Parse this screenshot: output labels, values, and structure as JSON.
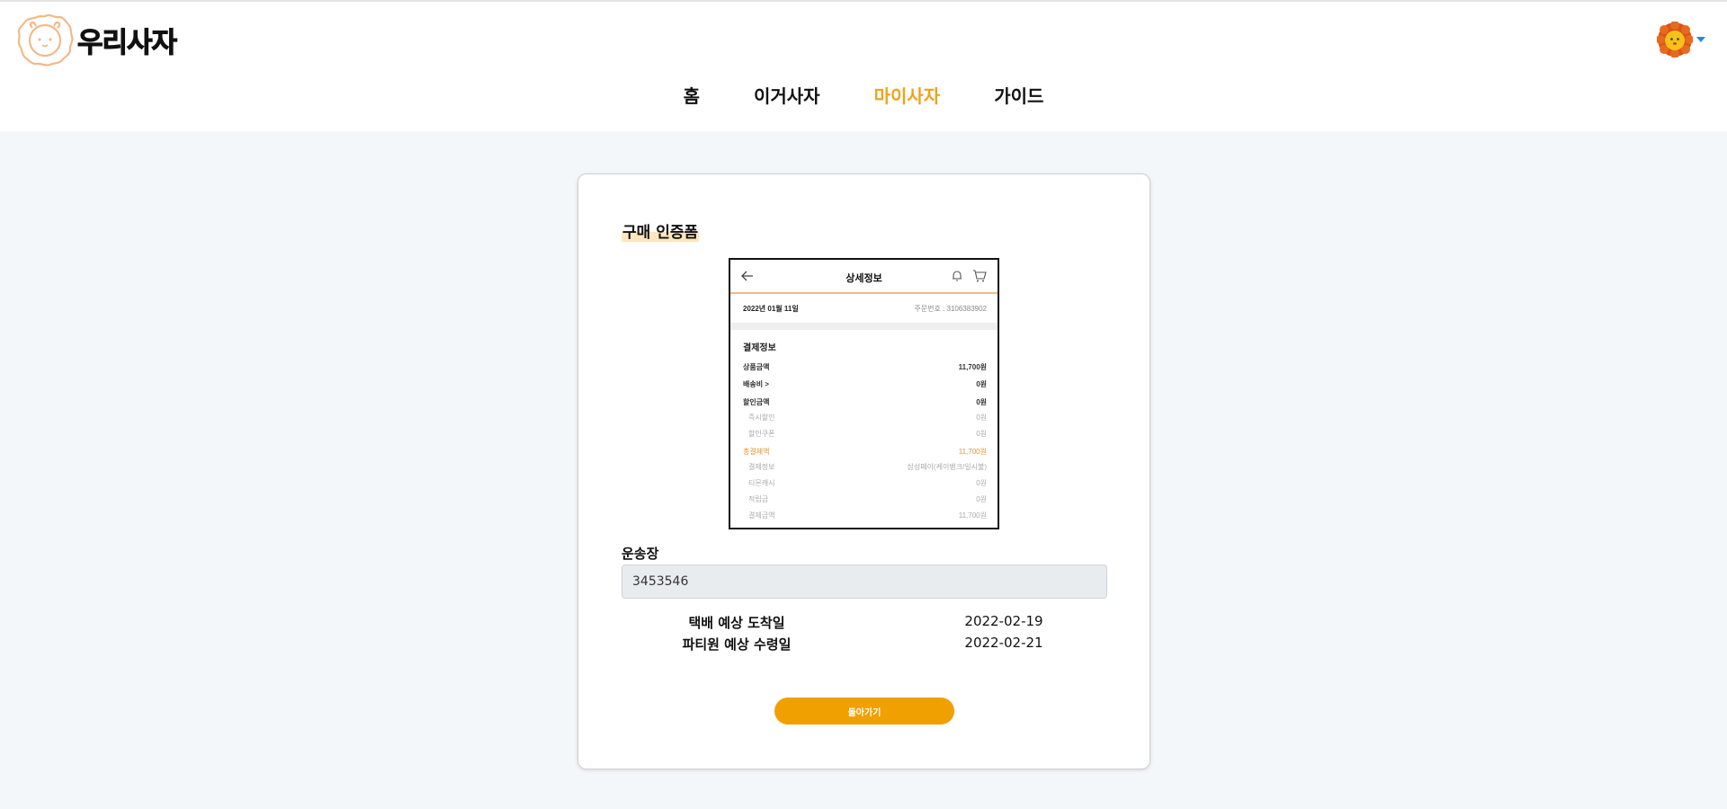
{
  "brand": {
    "name": "우리사자"
  },
  "nav": {
    "items": [
      {
        "label": "홈",
        "active": false
      },
      {
        "label": "이거사자",
        "active": false
      },
      {
        "label": "마이사자",
        "active": true
      },
      {
        "label": "가이드",
        "active": false
      }
    ]
  },
  "colors": {
    "accent": "#f0a31a",
    "button": "#f0a000",
    "highlight": "#fde6bd",
    "background": "#f4f7f9"
  },
  "card": {
    "title": "구매 인증폼",
    "receipt": {
      "title": "상세정보",
      "date": "2022년 01월 11일",
      "order_no": "주문번호 : 3106383902",
      "section": "결제정보",
      "rows": [
        {
          "key": "상품금액",
          "value": "11,700원",
          "style": "main"
        },
        {
          "key": "배송비 >",
          "value": "0원",
          "style": "main"
        },
        {
          "key": "할인금액",
          "value": "0원",
          "style": "main"
        },
        {
          "key": "즉시할인",
          "value": "0원",
          "style": "sub"
        },
        {
          "key": "할인쿠폰",
          "value": "0원",
          "style": "sub"
        },
        {
          "key": "총결제액",
          "value": "11,700원",
          "style": "total"
        },
        {
          "key": "결제정보",
          "value": "삼성페이(케이뱅크/일시불)",
          "style": "sub"
        },
        {
          "key": "티몬캐시",
          "value": "0원",
          "style": "sub"
        },
        {
          "key": "적립금",
          "value": "0원",
          "style": "sub"
        },
        {
          "key": "결제금액",
          "value": "11,700원",
          "style": "sub"
        }
      ]
    },
    "shipping_label": "운송장",
    "shipping_value": "3453546",
    "info": [
      {
        "label": "택배 예상 도착일",
        "value": "2022-02-19"
      },
      {
        "label": "파티원 예상 수령일",
        "value": "2022-02-21"
      }
    ],
    "back_button": "돌아가기"
  },
  "icons": [
    "lion-logo-icon",
    "lion-avatar-icon",
    "caret-down-icon",
    "back-arrow-icon",
    "bell-icon",
    "cart-icon"
  ]
}
